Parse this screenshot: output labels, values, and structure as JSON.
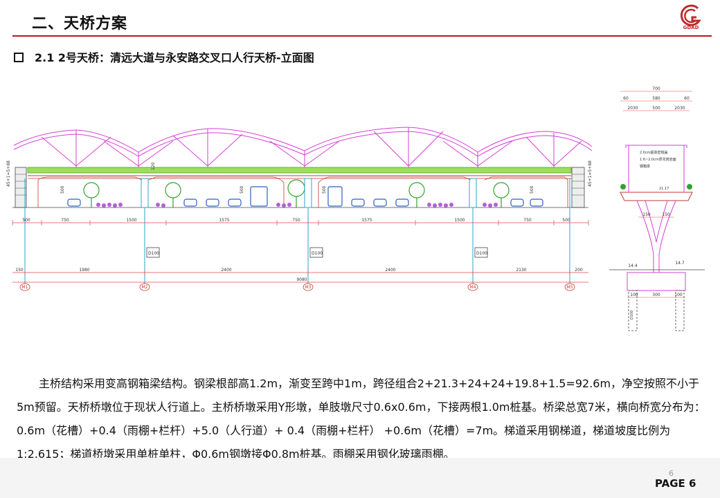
{
  "header": {
    "title": "二、天桥方案",
    "logo_text": "GDAD"
  },
  "subtitle": "2.1 2号天桥：清远大道与永安路交叉口人行天桥-立面图",
  "elevation": {
    "spans_top": [
      "500",
      "750",
      "1500",
      "1575",
      "750",
      "1575",
      "1500",
      "750",
      "500"
    ],
    "spans_pier": [
      "150",
      "1980",
      "2400",
      "2400",
      "2130",
      "200"
    ],
    "total": "9080",
    "piers": [
      "M1",
      "M2",
      "M3",
      "M4",
      "M5"
    ],
    "pile_labels": [
      "D100",
      "D100",
      "D100"
    ],
    "clearance": [
      "500",
      "500",
      "500",
      "500"
    ],
    "side_heights": [
      "45+1=5+88",
      "45+1=5+88"
    ],
    "deck_note": "120"
  },
  "cross_section": {
    "dims_top": [
      "700",
      "60",
      "580",
      "60"
    ],
    "dims_second": [
      "2030",
      "500",
      "2030"
    ],
    "notes": [
      "2.0cm超高密帽盖",
      "1.6~2.0cm厚花岗岩面",
      "钢箱梁"
    ],
    "levels": [
      "21.17",
      "14.4",
      "14.7"
    ],
    "dims_mid": [
      "150",
      "150"
    ],
    "dims_bottom": [
      "100",
      "300",
      "100"
    ],
    "pile": "D100"
  },
  "body_text": "主桥结构采用变高钢箱梁结构。钢梁根部高1.2m，渐变至跨中1m，跨径组合2+21.3+24+24+19.8+1.5=92.6m，净空按照不小于5m预留。天桥桥墩位于现状人行道上。主桥桥墩采用Y形墩，单肢墩尺寸0.6x0.6m，下接两根1.0m桩基。桥梁总宽7米，横向桥宽分布为： 0.6m（花槽）+0.4（雨棚+栏杆）+5.0（人行道）+ 0.4（雨棚+栏杆） +0.6m（花槽）=7m。梯道采用钢梯道，梯道坡度比例为1:2.615；梯道桥墩采用单桩单柱，Φ0.6m钢墩接Φ0.8m桩基。雨棚采用钢化玻璃雨棚。",
  "footer": {
    "page_number": "6",
    "page_label": "PAGE 6"
  },
  "colors": {
    "accent": "#b31b1b",
    "canopy": "#d63fd6",
    "deck": "#7fcf3a",
    "structure": "#c0392b",
    "dims": "#e24a4a",
    "vehicle": "#2a5fbf"
  }
}
